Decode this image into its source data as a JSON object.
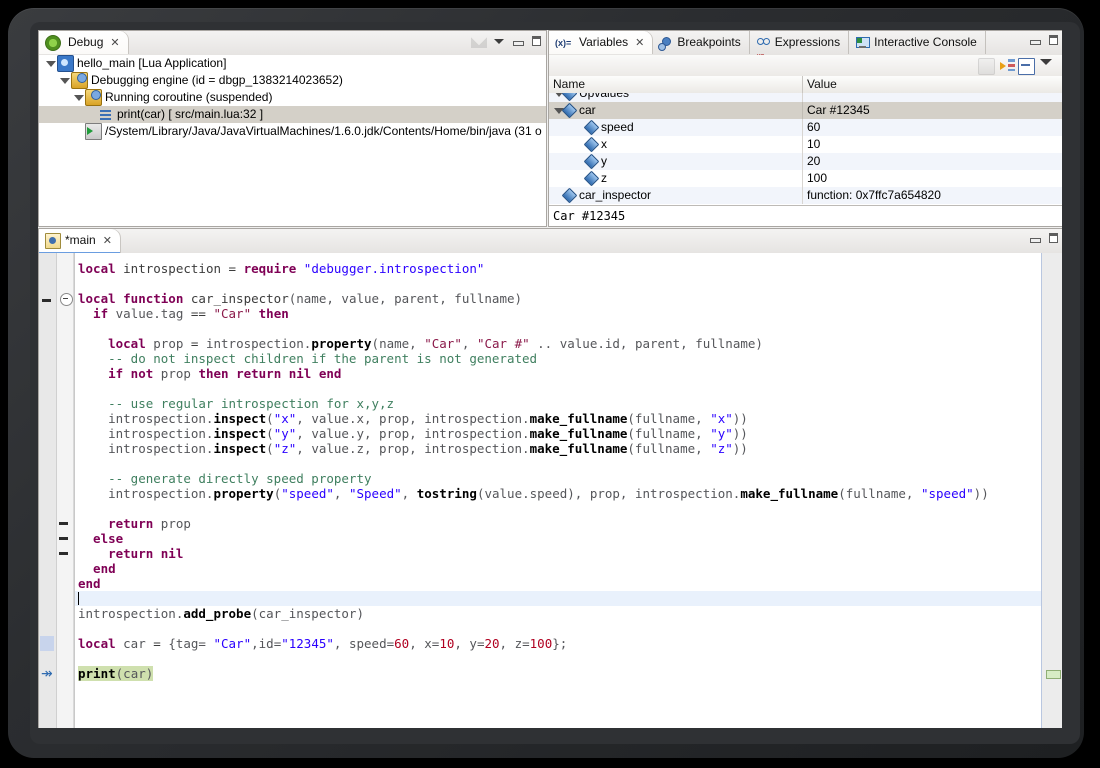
{
  "debug_view": {
    "tab_label": "Debug",
    "close_glyph": "✕",
    "tree": [
      {
        "label": "hello_main [Lua Application]",
        "icon": "launch-config-icon",
        "indent": 0,
        "twisty": "open",
        "selected": false
      },
      {
        "label": "Debugging engine (id = dbgp_1383214023652)",
        "icon": "debug-engine-icon",
        "indent": 1,
        "twisty": "open",
        "selected": false
      },
      {
        "label": "Running coroutine (suspended)",
        "icon": "thread-icon",
        "indent": 2,
        "twisty": "open",
        "selected": false
      },
      {
        "label": "print(car)  [ src/main.lua:32 ]",
        "icon": "stack-frame-icon",
        "indent": 3,
        "twisty": "none",
        "selected": true
      },
      {
        "label": "/System/Library/Java/JavaVirtualMachines/1.6.0.jdk/Contents/Home/bin/java (31 o",
        "icon": "process-icon",
        "indent": 2,
        "twisty": "none",
        "selected": false
      }
    ]
  },
  "variables_view": {
    "tabs": [
      {
        "label": "Variables",
        "icon": "variables-icon",
        "active": true,
        "close_glyph": "✕"
      },
      {
        "label": "Breakpoints",
        "icon": "breakpoints-icon",
        "active": false
      },
      {
        "label": "Expressions",
        "icon": "expressions-icon",
        "active": false
      },
      {
        "label": "Interactive Console",
        "icon": "console-icon",
        "active": false
      }
    ],
    "columns": {
      "name": "Name",
      "value": "Value"
    },
    "rows": [
      {
        "name": "Upvalues",
        "value": "",
        "indent": 1,
        "twisty": "open",
        "clipped": true,
        "selected": false
      },
      {
        "name": "car",
        "value": "Car #12345",
        "indent": 1,
        "twisty": "open",
        "clipped": false,
        "selected": true
      },
      {
        "name": "speed",
        "value": "60",
        "indent": 2,
        "twisty": "none",
        "clipped": false,
        "selected": false
      },
      {
        "name": "x",
        "value": "10",
        "indent": 2,
        "twisty": "none",
        "clipped": false,
        "selected": false
      },
      {
        "name": "y",
        "value": "20",
        "indent": 2,
        "twisty": "none",
        "clipped": false,
        "selected": false
      },
      {
        "name": "z",
        "value": "100",
        "indent": 2,
        "twisty": "none",
        "clipped": false,
        "selected": false
      },
      {
        "name": "car_inspector",
        "value": "function: 0x7ffc7a654820",
        "indent": 1,
        "twisty": "none",
        "clipped": false,
        "selected": false
      }
    ],
    "detail_pane": "Car #12345"
  },
  "editor": {
    "tab_label": "*main",
    "close_glyph": "✕",
    "lines": [
      {
        "indent": 2,
        "tokens": [
          {
            "t": "local ",
            "c": "k"
          },
          {
            "t": "introspection ",
            "c": "p"
          },
          {
            "t": "= ",
            "c": "p"
          },
          {
            "t": "require ",
            "c": "k"
          },
          {
            "t": "\"debugger.introspection\"",
            "c": "s"
          }
        ]
      },
      {
        "indent": 0,
        "tokens": []
      },
      {
        "indent": 0,
        "tokens": [
          {
            "t": "local function ",
            "c": "k"
          },
          {
            "t": "car_inspector",
            "c": "p"
          },
          {
            "t": "(name, value, parent, fullname)",
            "c": "id"
          }
        ],
        "fold": "collapse"
      },
      {
        "indent": 1,
        "tokens": [
          {
            "t": "  if ",
            "c": "k"
          },
          {
            "t": "value.tag ",
            "c": "id"
          },
          {
            "t": "== ",
            "c": "p"
          },
          {
            "t": "\"Car\"",
            "c": "s2"
          },
          {
            "t": " then",
            "c": "k"
          }
        ]
      },
      {
        "indent": 0,
        "tokens": []
      },
      {
        "indent": 0,
        "tokens": [
          {
            "t": "    local ",
            "c": "k"
          },
          {
            "t": "prop ",
            "c": "id"
          },
          {
            "t": "= ",
            "c": "p"
          },
          {
            "t": "introspection.",
            "c": "id"
          },
          {
            "t": "property",
            "c": "m"
          },
          {
            "t": "(name, ",
            "c": "id"
          },
          {
            "t": "\"Car\"",
            "c": "s2"
          },
          {
            "t": ", ",
            "c": "id"
          },
          {
            "t": "\"Car #\"",
            "c": "s2"
          },
          {
            "t": " .. value.id, parent, fullname)",
            "c": "id"
          }
        ]
      },
      {
        "indent": 0,
        "tokens": [
          {
            "t": "    -- do not inspect children if the parent is not generated",
            "c": "c"
          }
        ]
      },
      {
        "indent": 0,
        "tokens": [
          {
            "t": "    if not ",
            "c": "k"
          },
          {
            "t": "prop ",
            "c": "id"
          },
          {
            "t": "then return nil end",
            "c": "k"
          }
        ]
      },
      {
        "indent": 0,
        "tokens": []
      },
      {
        "indent": 0,
        "tokens": [
          {
            "t": "    -- use regular introspection for x,y,z",
            "c": "c"
          }
        ]
      },
      {
        "indent": 0,
        "tokens": [
          {
            "t": "    introspection.",
            "c": "id"
          },
          {
            "t": "inspect",
            "c": "m"
          },
          {
            "t": "(",
            "c": "id"
          },
          {
            "t": "\"x\"",
            "c": "s"
          },
          {
            "t": ", value.x, prop, introspection.",
            "c": "id"
          },
          {
            "t": "make_fullname",
            "c": "m"
          },
          {
            "t": "(fullname, ",
            "c": "id"
          },
          {
            "t": "\"x\"",
            "c": "s"
          },
          {
            "t": "))",
            "c": "id"
          }
        ]
      },
      {
        "indent": 0,
        "tokens": [
          {
            "t": "    introspection.",
            "c": "id"
          },
          {
            "t": "inspect",
            "c": "m"
          },
          {
            "t": "(",
            "c": "id"
          },
          {
            "t": "\"y\"",
            "c": "s"
          },
          {
            "t": ", value.y, prop, introspection.",
            "c": "id"
          },
          {
            "t": "make_fullname",
            "c": "m"
          },
          {
            "t": "(fullname, ",
            "c": "id"
          },
          {
            "t": "\"y\"",
            "c": "s"
          },
          {
            "t": "))",
            "c": "id"
          }
        ]
      },
      {
        "indent": 0,
        "tokens": [
          {
            "t": "    introspection.",
            "c": "id"
          },
          {
            "t": "inspect",
            "c": "m"
          },
          {
            "t": "(",
            "c": "id"
          },
          {
            "t": "\"z\"",
            "c": "s"
          },
          {
            "t": ", value.z, prop, introspection.",
            "c": "id"
          },
          {
            "t": "make_fullname",
            "c": "m"
          },
          {
            "t": "(fullname, ",
            "c": "id"
          },
          {
            "t": "\"z\"",
            "c": "s"
          },
          {
            "t": "))",
            "c": "id"
          }
        ]
      },
      {
        "indent": 0,
        "tokens": []
      },
      {
        "indent": 0,
        "tokens": [
          {
            "t": "    -- generate directly speed property",
            "c": "c"
          }
        ]
      },
      {
        "indent": 0,
        "tokens": [
          {
            "t": "    introspection.",
            "c": "id"
          },
          {
            "t": "property",
            "c": "m"
          },
          {
            "t": "(",
            "c": "id"
          },
          {
            "t": "\"speed\"",
            "c": "s"
          },
          {
            "t": ", ",
            "c": "id"
          },
          {
            "t": "\"Speed\"",
            "c": "s"
          },
          {
            "t": ", ",
            "c": "id"
          },
          {
            "t": "tostring",
            "c": "m"
          },
          {
            "t": "(value.speed), prop, introspection.",
            "c": "id"
          },
          {
            "t": "make_fullname",
            "c": "m"
          },
          {
            "t": "(fullname, ",
            "c": "id"
          },
          {
            "t": "\"speed\"",
            "c": "s"
          },
          {
            "t": "))",
            "c": "id"
          }
        ]
      },
      {
        "indent": 0,
        "tokens": []
      },
      {
        "indent": 0,
        "tokens": [
          {
            "t": "    return ",
            "c": "k"
          },
          {
            "t": "prop",
            "c": "id"
          }
        ],
        "fold": "dash"
      },
      {
        "indent": 0,
        "tokens": [
          {
            "t": "  else",
            "c": "k"
          }
        ],
        "fold": "dash"
      },
      {
        "indent": 0,
        "tokens": [
          {
            "t": "    return nil",
            "c": "k"
          }
        ],
        "fold": "dash"
      },
      {
        "indent": 0,
        "tokens": [
          {
            "t": "  end",
            "c": "k"
          }
        ]
      },
      {
        "indent": 0,
        "tokens": [
          {
            "t": "end",
            "c": "k"
          }
        ]
      },
      {
        "indent": 0,
        "tokens": [],
        "caret": true
      },
      {
        "indent": 0,
        "tokens": [
          {
            "t": "introspection.",
            "c": "id"
          },
          {
            "t": "add_probe",
            "c": "m"
          },
          {
            "t": "(car_inspector)",
            "c": "id"
          }
        ]
      },
      {
        "indent": 0,
        "tokens": []
      },
      {
        "indent": 0,
        "tokens": [
          {
            "t": "local ",
            "c": "k"
          },
          {
            "t": "car ",
            "c": "id"
          },
          {
            "t": "= ",
            "c": "p"
          },
          {
            "t": "{tag= ",
            "c": "id"
          },
          {
            "t": "\"Car\"",
            "c": "s"
          },
          {
            "t": ",id=",
            "c": "id"
          },
          {
            "t": "\"12345\"",
            "c": "s"
          },
          {
            "t": ", speed=",
            "c": "id"
          },
          {
            "t": "60",
            "c": "n"
          },
          {
            "t": ", x=",
            "c": "id"
          },
          {
            "t": "10",
            "c": "n"
          },
          {
            "t": ", y=",
            "c": "id"
          },
          {
            "t": "20",
            "c": "n"
          },
          {
            "t": ", z=",
            "c": "id"
          },
          {
            "t": "100",
            "c": "n"
          },
          {
            "t": "};",
            "c": "id"
          }
        ],
        "changed": true
      },
      {
        "indent": 0,
        "tokens": []
      },
      {
        "indent": 0,
        "tokens": [
          {
            "t": "print",
            "c": "m"
          },
          {
            "t": "(car)",
            "c": "id"
          }
        ],
        "exec": true
      }
    ]
  }
}
